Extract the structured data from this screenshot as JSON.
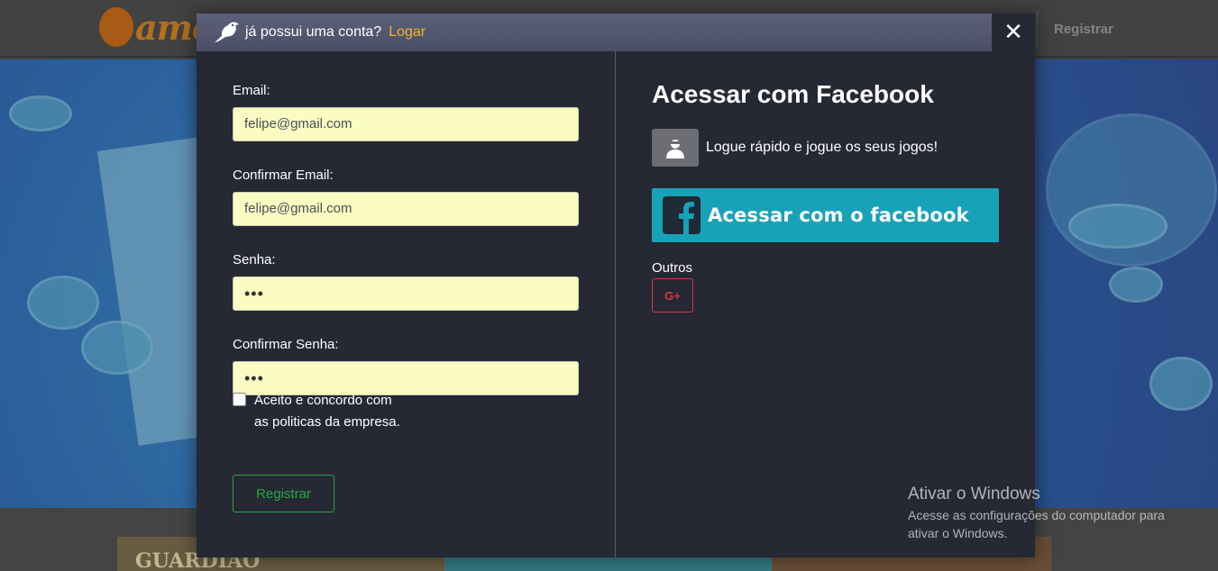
{
  "background": {
    "logo_text": "ame",
    "register_label": "Registrar",
    "tile_title": "GUARDIÃO"
  },
  "modal": {
    "header": {
      "crow_icon": "crow-icon",
      "text": "já possui uma conta?",
      "login_link": "Logar",
      "close_icon": "close-icon",
      "close_label": "✕"
    },
    "form": {
      "email_label": "Email:",
      "email_value": "felipe@gmail.com",
      "confirm_email_label": "Confirmar Email:",
      "confirm_email_value": "felipe@gmail.com",
      "password_label": "Senha:",
      "password_value": "•••",
      "confirm_password_label": "Confirmar Senha:",
      "confirm_password_value": "•••",
      "terms_checked": false,
      "terms_text": "Aceito e concordo com as politicas da empresa.",
      "register_button": "Registrar"
    },
    "social": {
      "title": "Acessar com Facebook",
      "tagline_icon": "user-icon",
      "tagline": "Logue rápido e jogue os seus jogos!",
      "facebook_icon": "facebook-icon",
      "facebook_button": "Acessar com o facebook",
      "others_label": "Outros",
      "gplus_icon": "google-plus-icon",
      "gplus_label": "G+"
    }
  },
  "watermark": {
    "title": "Ativar o Windows",
    "subtitle": "Acesse as configurações do computador para ativar o Windows."
  },
  "colors": {
    "modal_bg": "#262834",
    "header_bg": "#4a4e66",
    "link": "#f0b429",
    "input_bg": "#fafcc2",
    "success": "#28a745",
    "facebook_btn": "#17a2b8",
    "danger": "#dc3545"
  }
}
